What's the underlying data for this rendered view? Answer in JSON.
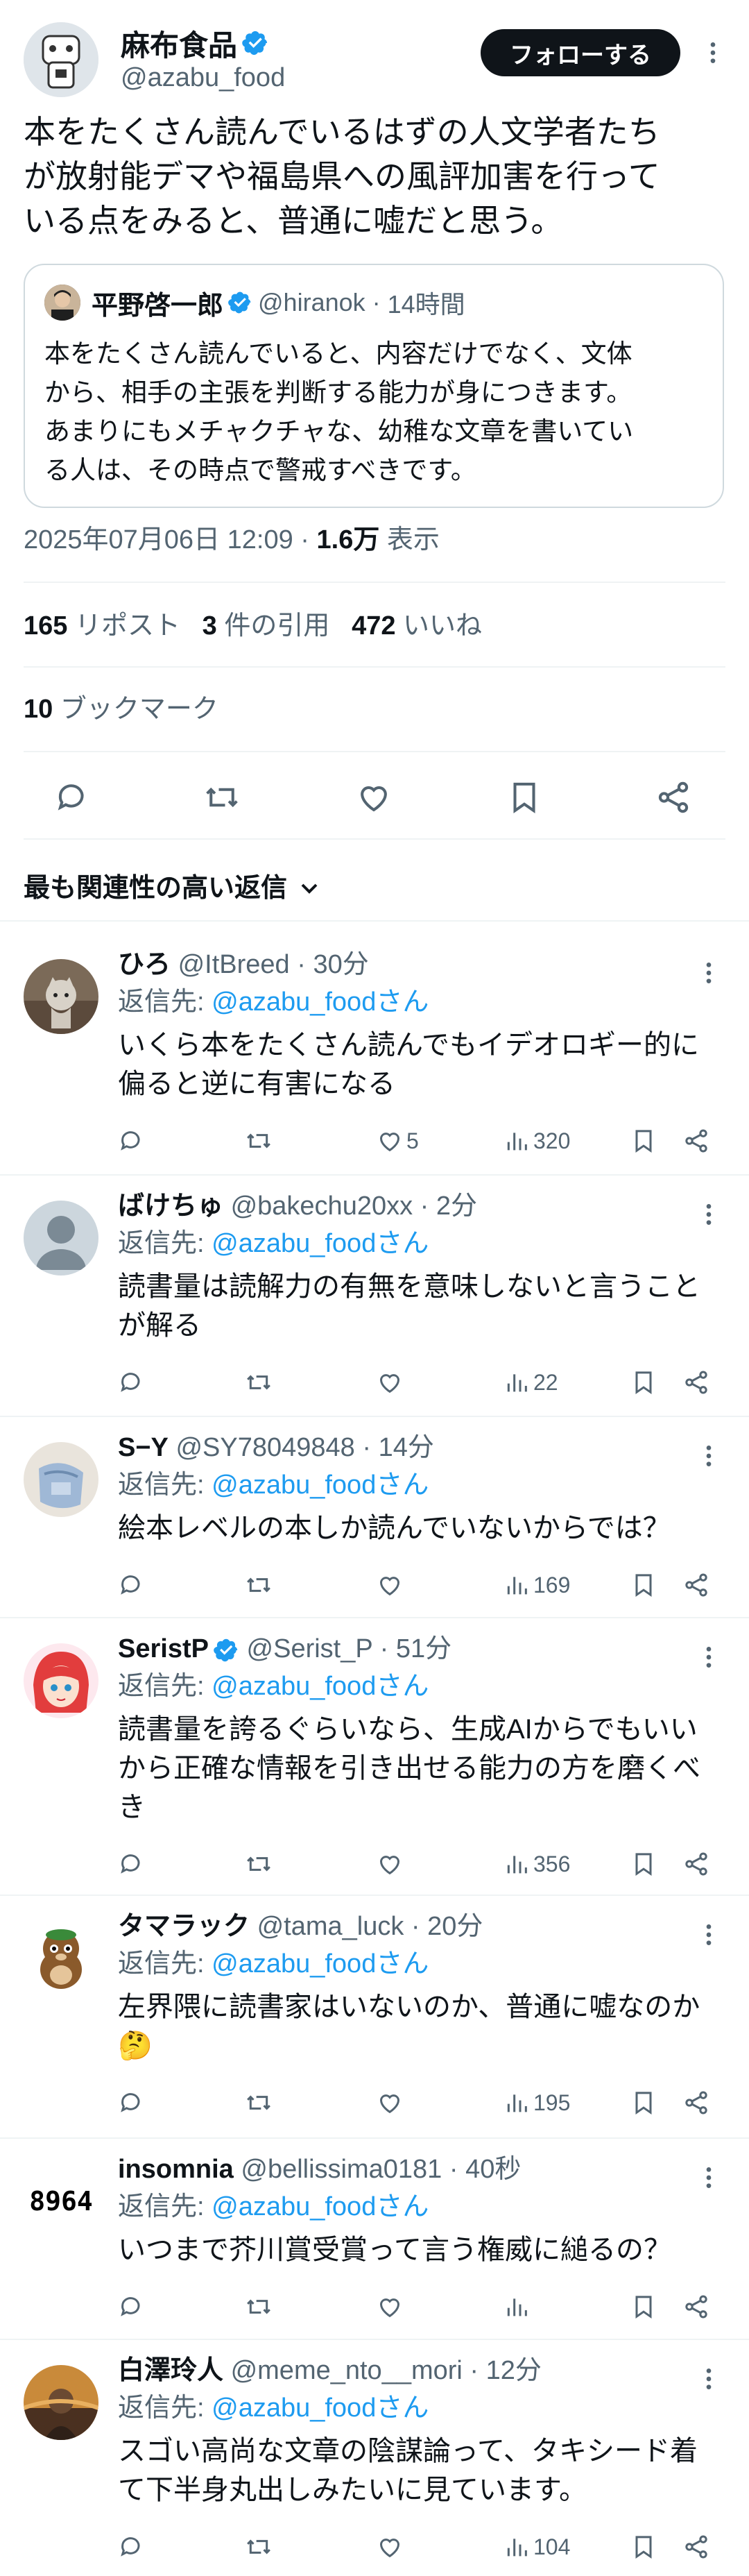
{
  "post": {
    "author_name": "麻布食品",
    "author_handle": "@azabu_food",
    "follow_label": "フォローする",
    "text_lines": [
      "本をたくさん読んでいるはずの人文学者たち",
      "が放射能デマや福島県への風評加害を行って",
      "いる点をみると、普通に嘘だと思う。"
    ],
    "quote": {
      "author_name": "平野啓一郎",
      "author_handle": "@hiranok",
      "time": "14時間",
      "text_lines": [
        "本をたくさん読んでいると、内容だけでなく、文体",
        "から、相手の主張を判断する能力が身につきます。",
        "あまりにもメチャクチャな、幼稚な文章を書いてい",
        "る人は、その時点で警戒すべきです。"
      ]
    },
    "timestamp": "2025年07月06日 12:09",
    "views_count": "1.6万",
    "views_label": "表示",
    "reposts_count": "165",
    "reposts_label": "リポスト",
    "quotes_count": "3",
    "quotes_label": "件の引用",
    "likes_count": "472",
    "likes_label": "いいね",
    "bookmarks_count": "10",
    "bookmarks_label": "ブックマーク"
  },
  "sort_label": "最も関連性の高い返信",
  "replies": [
    {
      "name": "ひろ",
      "handle": "@ItBreed",
      "time": "30分",
      "verified": false,
      "reply_prefix": "返信先: ",
      "reply_to": "@azabu_foodさん",
      "text_lines": [
        "いくら本をたくさん読んでもイデオロギー的に",
        "偏ると逆に有害になる"
      ],
      "likes": "5",
      "views": "320"
    },
    {
      "name": "ばけちゅ",
      "handle": "@bakechu20xx",
      "time": "2分",
      "verified": false,
      "reply_prefix": "返信先: ",
      "reply_to": "@azabu_foodさん",
      "text_lines": [
        "読書量は読解力の有無を意味しないと言うこと",
        "が解る"
      ],
      "likes": "",
      "views": "22"
    },
    {
      "name": "S−Y",
      "handle": "@SY78049848",
      "time": "14分",
      "verified": false,
      "reply_prefix": "返信先: ",
      "reply_to": "@azabu_foodさん",
      "text_lines": [
        "絵本レベルの本しか読んでいないからでは？"
      ],
      "likes": "",
      "views": "169"
    },
    {
      "name": "SeristP",
      "handle": "@Serist_P",
      "time": "51分",
      "verified": true,
      "reply_prefix": "返信先: ",
      "reply_to": "@azabu_foodさん",
      "text_lines": [
        "読書量を誇るぐらいなら、生成AIからでもいい",
        "から正確な情報を引き出せる能力の方を磨くべ",
        "き"
      ],
      "likes": "",
      "views": "356"
    },
    {
      "name": "タマラック",
      "handle": "@tama_luck",
      "time": "20分",
      "verified": false,
      "reply_prefix": "返信先: ",
      "reply_to": "@azabu_foodさん",
      "text_lines": [
        "左界隈に読書家はいないのか、普通に嘘なのか",
        "🤔"
      ],
      "likes": "",
      "views": "195"
    },
    {
      "name": "insomnia",
      "handle": "@bellissima0181",
      "time": "40秒",
      "verified": false,
      "reply_prefix": "返信先: ",
      "reply_to": "@azabu_foodさん",
      "avatar_text": "8964",
      "text_lines": [
        "いつまで芥川賞受賞って言う権威に縋るの？"
      ],
      "likes": "",
      "views": ""
    },
    {
      "name": "白澤玲人",
      "handle": "@meme_nto__mori",
      "time": "12分",
      "verified": false,
      "reply_prefix": "返信先: ",
      "reply_to": "@azabu_foodさん",
      "text_lines": [
        "スゴい高尚な文章の陰謀論って、タキシード着",
        "て下半身丸出しみたいに見ています。"
      ],
      "likes": "",
      "views": "104"
    }
  ],
  "colors": {
    "accent": "#1d9bf0",
    "text": "#0f1419",
    "secondary": "#536471",
    "divider": "#eff3f4",
    "follow_bg": "#0f1419"
  }
}
